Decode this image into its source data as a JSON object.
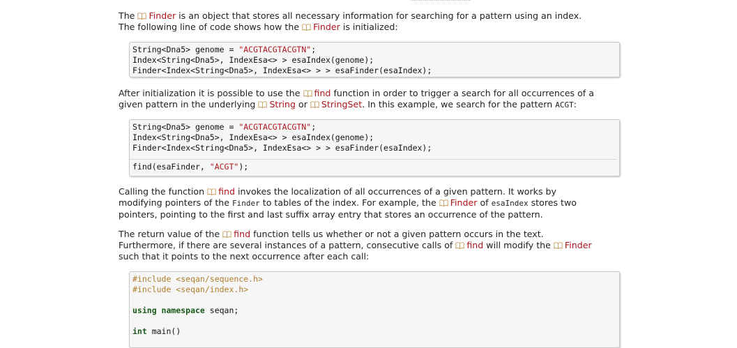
{
  "paragraphs": {
    "p1": {
      "t1": "The ",
      "r1": "Finder",
      "t2": " is an object that stores all necessary information for searching for a pattern using an index.",
      "t3": "The following line of code shows how the ",
      "r2": "Finder",
      "t4": " is initialized:"
    },
    "p2": {
      "t1": "After initialization it is possible to use the ",
      "r1": "find",
      "t2": " function in order to trigger a search for all occurrences of a",
      "t3": "given pattern in the underlying ",
      "r2": "String",
      "t4": " or ",
      "r3": "StringSet",
      "t5": ". In this example, we search for the pattern ",
      "c1": "ACGT",
      "t6": ":"
    },
    "p3": {
      "t1": "Calling the function ",
      "r1": "find",
      "t2": " invokes the localization of all occurrences of a given pattern. It works by",
      "t3": "modifying pointers of the ",
      "c1": "Finder",
      "t4": " to tables of the index. For example, the ",
      "r2": "Finder",
      "t5": " of ",
      "c2": "esaIndex",
      "t6": " stores two",
      "t7": "pointers, pointing to the first and last suffix array entry that stores an occurrence of the pattern."
    },
    "p4": {
      "t1": "The return value of the ",
      "r1": "find",
      "t2": " function tells us whether or not a given pattern occurs in the text.",
      "t3": "Furthermore, if there are several instances of a pattern, consecutive calls of ",
      "r2": "find",
      "t4": " will modify the ",
      "r3": "Finder",
      "t5": "such that it points to the next occurrence after each call:"
    }
  },
  "code1": {
    "l1a": "String<Dna5> genome = ",
    "l1s": "\"ACGTACGTACGTN\"",
    "l1b": ";",
    "l2": "Index<String<Dna5>, IndexEsa<> > esaIndex(genome);",
    "l3": "Finder<Index<String<Dna5>, IndexEsa<> > > esaFinder(esaIndex);"
  },
  "code2": {
    "l1a": "String<Dna5> genome = ",
    "l1s": "\"ACGTACGTACGTN\"",
    "l1b": ";",
    "l2": "Index<String<Dna5>, IndexEsa<> > esaIndex(genome);",
    "l3": "Finder<Index<String<Dna5>, IndexEsa<> > > esaFinder(esaIndex);",
    "l4a": "find(esaFinder, ",
    "l4s": "\"ACGT\"",
    "l4b": ");"
  },
  "code3": {
    "l1": "#include <seqan/sequence.h>",
    "l2": "#include <seqan/index.h>",
    "l3k": "using namespace",
    "l3b": " seqan;",
    "l4k": "int",
    "l4b": " main()"
  },
  "colors": {
    "link": "#b0151c",
    "string": "#b0151c",
    "preprocessor": "#b07d2b",
    "keyword": "#1a5a1a"
  },
  "icons": {
    "doc_link": "book-icon"
  }
}
